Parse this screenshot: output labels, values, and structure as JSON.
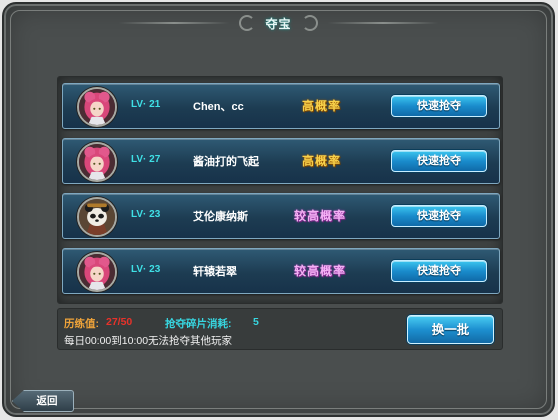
{
  "title": "夺宝",
  "rows": [
    {
      "level": "LV· 21",
      "name": "Chen、cc",
      "probability": "高概率",
      "prob_class": "high",
      "button": "快速抢夺",
      "avatar": "pink-hair-girl"
    },
    {
      "level": "LV· 27",
      "name": "酱油打的飞起",
      "probability": "高概率",
      "prob_class": "high",
      "button": "快速抢夺",
      "avatar": "pink-hair-girl"
    },
    {
      "level": "LV· 23",
      "name": "艾伦康纳斯",
      "probability": "较高概率",
      "prob_class": "higher",
      "button": "快速抢夺",
      "avatar": "panda-warrior"
    },
    {
      "level": "LV· 23",
      "name": "轩辕若翠",
      "probability": "较高概率",
      "prob_class": "higher",
      "button": "快速抢夺",
      "avatar": "pink-hair-girl"
    }
  ],
  "info": {
    "exp_label": "历练值:",
    "exp_value": "27/50",
    "cost_label": "抢夺碎片消耗:",
    "cost_value": "5",
    "notice": "每日00:00到10:00无法抢夺其他玩家"
  },
  "refresh_button": "换一批",
  "back_button": "返回",
  "colors": {
    "level": "#3fe0e6",
    "high_prob": "#f7d04a",
    "higher_prob": "#f3b0f4",
    "exp_label": "#f0a43a",
    "exp_value": "#e8322a",
    "cost": "#37d6e0"
  }
}
